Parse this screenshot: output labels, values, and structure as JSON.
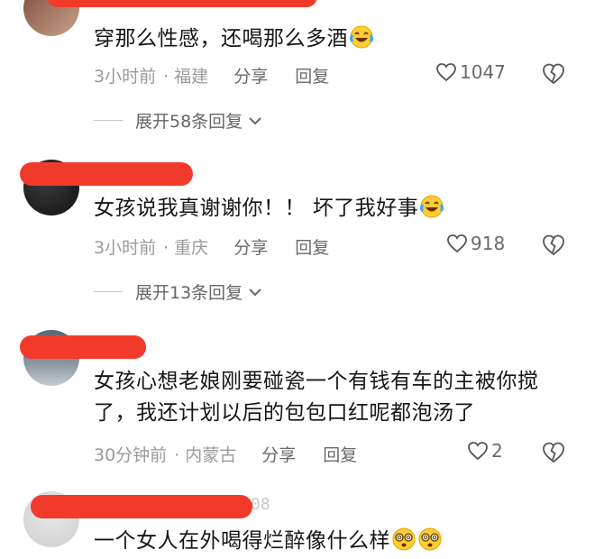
{
  "comments": [
    {
      "text": "穿那么性感，还喝那么多酒",
      "time": "3小时前",
      "location": "· 福建",
      "share": "分享",
      "reply": "回复",
      "likes": "1047",
      "expand": "展开58条回复",
      "emoji": "laughing-crying-emoji"
    },
    {
      "text": "女孩说我真谢谢你！！ 坏了我好事",
      "time": "3小时前",
      "location": "· 重庆",
      "share": "分享",
      "reply": "回复",
      "likes": "918",
      "expand": "展开13条回复",
      "emoji": "laughing-crying-emoji"
    },
    {
      "text_line1": "女孩心想老娘刚要碰瓷一个有钱有车的主被你搅",
      "text_line2": "了，我还计划以后的包包口红呢都泡汤了",
      "time": "30分钟前",
      "location": "· 内蒙古",
      "share": "分享",
      "reply": "回复",
      "likes": "2"
    },
    {
      "text": "一个女人在外喝得烂醉像什么样",
      "emoji": "dizzy-face-emoji",
      "ghost_suffix": "08"
    }
  ],
  "colors": {
    "redaction": "#f23a2b",
    "meta_text": "#9a9a9a",
    "body_text": "#161616"
  }
}
